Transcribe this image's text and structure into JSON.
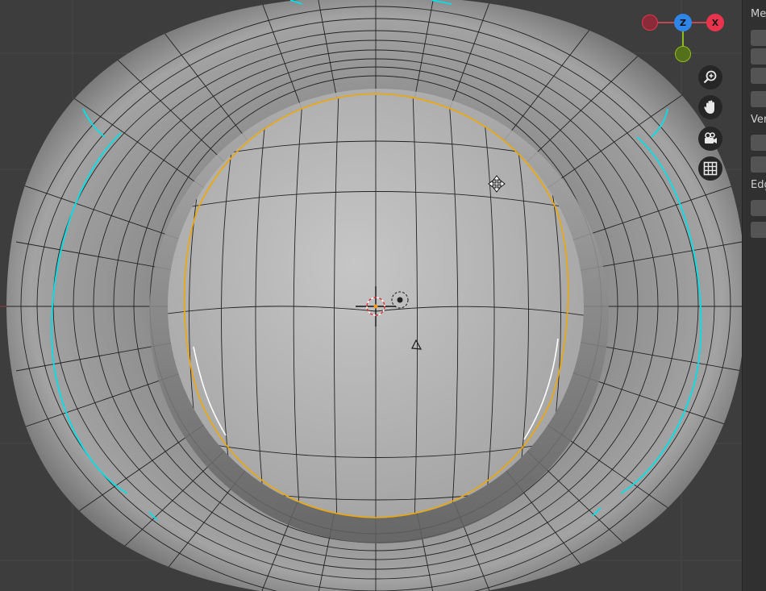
{
  "viewport": {
    "background": "#3d3d3d",
    "selection_color": "#f0a800",
    "seam_color": "#00e0e8"
  },
  "gizmo": {
    "z_label": "Z",
    "x_label": "X",
    "colors": {
      "x": "#e8344c",
      "y": "#8bbf1a",
      "z": "#2f86e8"
    }
  },
  "navigation": {
    "icons": [
      "zoom-icon",
      "pan-hand-icon",
      "camera-icon",
      "grid-icon"
    ]
  },
  "side_panel": {
    "labels": [
      "Me",
      "Ver",
      "Edg"
    ]
  }
}
